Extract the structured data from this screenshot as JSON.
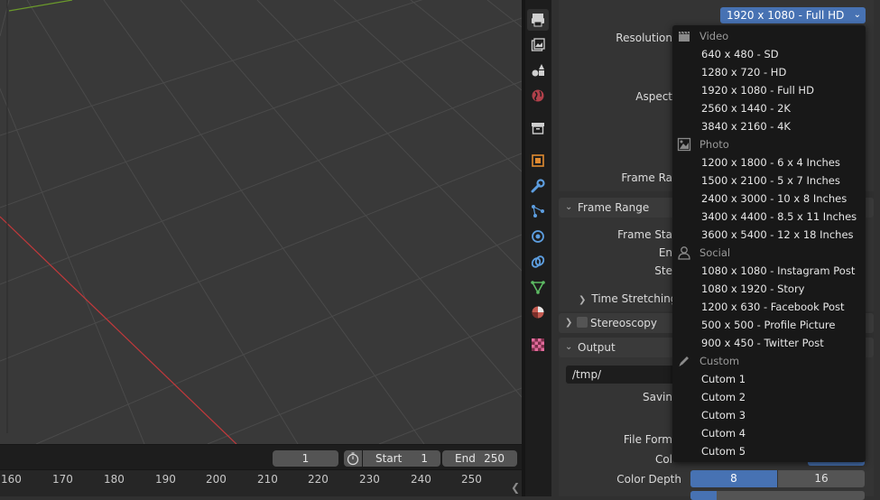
{
  "resolution_preset": {
    "value": "1920 x 1080 - Full HD"
  },
  "menu": {
    "categories": [
      {
        "label": "Video",
        "icon": "clapperboard-icon",
        "items": [
          "640 x 480 - SD",
          "1280 x 720 - HD",
          "1920 x 1080 - Full HD",
          "2560 x 1440 - 2K",
          "3840 x 2160 - 4K"
        ]
      },
      {
        "label": "Photo",
        "icon": "image-icon",
        "items": [
          "1200 x 1800 - 6 x 4 Inches",
          "1500 x 2100 - 5 x 7 Inches",
          "2400 x 3000 - 10 x 8 Inches",
          "3400 x 4400 - 8.5 x 11 Inches",
          "3600 x 5400 - 12 x 18 Inches"
        ]
      },
      {
        "label": "Social",
        "icon": "user-icon",
        "items": [
          "1080 x 1080 - Instagram Post",
          "1080 x 1920 - Story",
          "1200 x 630 - Facebook Post",
          "500 x 500 - Profile Picture",
          "900 x 450 - Twitter Post"
        ]
      },
      {
        "label": "Custom",
        "icon": "pencil-icon",
        "items": [
          "Cutom 1",
          "Cutom 2",
          "Cutom 3",
          "Cutom 4",
          "Cutom 5"
        ]
      }
    ]
  },
  "props": {
    "resolution_label": "Resolution",
    "aspect_label": "Aspect",
    "frame_rate_label": "Frame Ra",
    "frame_range": {
      "title": "Frame Range",
      "frame_start_label": "Frame Sta",
      "end_label": "En",
      "step_label": "Ste"
    },
    "time_stretching": "Time Stretching",
    "stereoscopy": "Stereoscopy",
    "output": {
      "title": "Output",
      "path": "/tmp/",
      "saving_label": "Savin",
      "file_format_label": "File Form",
      "color_label": "Col"
    },
    "color_depth": {
      "label": "Color Depth",
      "options": [
        "8",
        "16"
      ],
      "selected": "8"
    },
    "compression_level": 0.15
  },
  "timeline": {
    "current_frame": "1",
    "start_label": "Start",
    "start_value": "1",
    "end_label": "End",
    "end_value": "250",
    "ruler_ticks": [
      "160",
      "170",
      "180",
      "190",
      "200",
      "210",
      "220",
      "230",
      "240",
      "250"
    ]
  },
  "colors": {
    "accent": "#4772b3",
    "menu_bg": "#181818",
    "x_axis": "#c0393b",
    "y_axis": "#6b9a2b"
  },
  "tabs": [
    "render-icon",
    "output-icon",
    "view-layer-icon",
    "scene-icon",
    "world-icon",
    "collection-icon",
    "object-icon",
    "modifier-icon",
    "particles-icon",
    "physics-icon",
    "constraints-icon",
    "data-icon",
    "material-icon",
    "texture-icon"
  ]
}
